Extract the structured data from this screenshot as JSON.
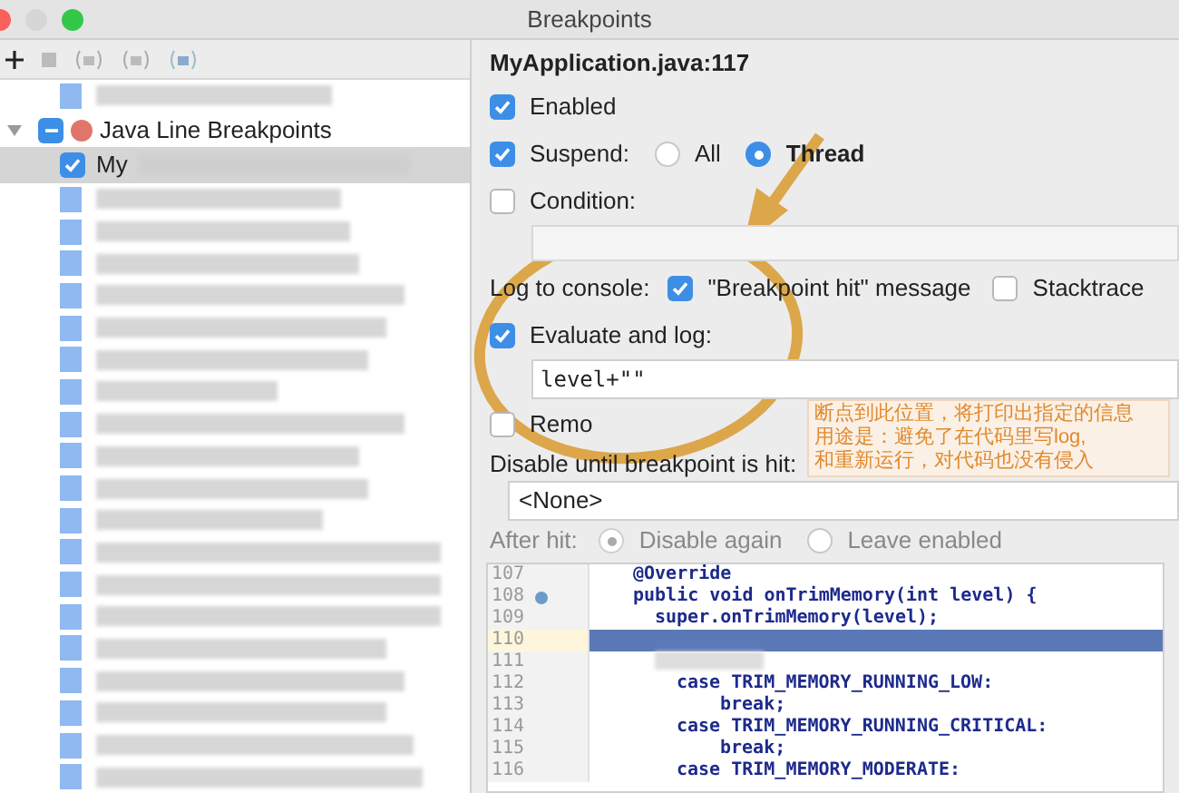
{
  "window": {
    "title": "Breakpoints"
  },
  "tree": [
    {
      "label": "Java Line Breakpoints",
      "expanded": true,
      "checked": true,
      "mixed": true,
      "children": [
        {
          "label": "My",
          "checked": true,
          "selected": true
        }
      ]
    }
  ],
  "details": {
    "title": "MyApplication.java:117",
    "enabled": {
      "label": "Enabled",
      "checked": true
    },
    "suspend": {
      "label": "Suspend:",
      "checked": true,
      "options": [
        {
          "label": "All",
          "selected": false
        },
        {
          "label": "Thread",
          "selected": true
        }
      ]
    },
    "condition": {
      "label": "Condition:",
      "checked": false
    },
    "log_to_console": {
      "label": "Log to console:",
      "options": [
        {
          "label": "\"Breakpoint hit\" message",
          "checked": true
        },
        {
          "label": "Stacktrace",
          "checked": false
        }
      ]
    },
    "evaluate": {
      "label": "Evaluate and log:",
      "checked": true,
      "value": "level+\"\""
    },
    "remove": {
      "label": "Remo",
      "checked": false
    },
    "disable_until": {
      "label": "Disable until breakpoint is hit:",
      "value": "<None>"
    },
    "after_hit": {
      "label": "After hit:",
      "disabled": true,
      "options": [
        {
          "label": "Disable again",
          "selected": true
        },
        {
          "label": "Leave enabled",
          "selected": false
        }
      ]
    }
  },
  "code": [
    {
      "number": "107",
      "text": "@Override",
      "marker": false,
      "highlighted": false
    },
    {
      "number": "108",
      "text": "public void onTrimMemory(int level) {",
      "marker": true,
      "highlighted": false
    },
    {
      "number": "109",
      "text": "super.onTrimMemory(level);",
      "marker": false,
      "highlighted": false
    },
    {
      "number": "110",
      "marker": false,
      "highlighted": true
    },
    {
      "number": "111",
      "marker": false,
      "highlighted": false
    },
    {
      "number": "112",
      "text": "case TRIM_MEMORY_RUNNING_LOW:",
      "marker": false,
      "highlighted": false
    },
    {
      "number": "113",
      "text": "break;",
      "marker": false,
      "highlighted": false
    },
    {
      "number": "114",
      "text": "case TRIM_MEMORY_RUNNING_CRITICAL:",
      "marker": false,
      "highlighted": false
    },
    {
      "number": "115",
      "text": "break;",
      "marker": false,
      "highlighted": false
    },
    {
      "number": "116",
      "text": "case TRIM_MEMORY_MODERATE:",
      "marker": false,
      "highlighted": false
    }
  ],
  "annotation": {
    "lines": [
      "断点到此位置，将打印出指定的信息",
      "用途是：避免了在代码里写log,",
      "和重新运行，对代码也没有侵入"
    ]
  }
}
